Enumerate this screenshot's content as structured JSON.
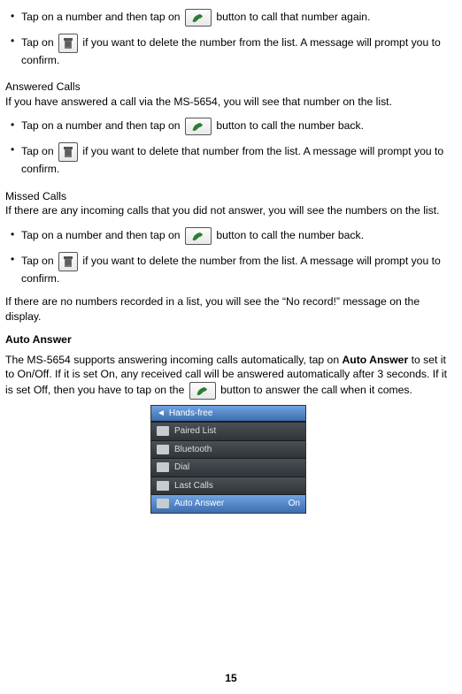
{
  "page_number": "15",
  "top_bullets": [
    {
      "pre": "Tap on a number and then tap on ",
      "icon": "phone",
      "post": " button to call that number again."
    },
    {
      "pre": "Tap on ",
      "icon": "trash",
      "post": " if you want to delete the number from the list. A message will prompt you to confirm."
    }
  ],
  "answered": {
    "title": "Answered Calls",
    "intro": "If you have answered a call via the MS-5654, you will see that number on the list.",
    "bullets": [
      {
        "pre": "Tap on a number and then tap on ",
        "icon": "phone",
        "post": " button to call the number back."
      },
      {
        "pre": "Tap on ",
        "icon": "trash",
        "post": " if you want to delete that number from the list. A message will prompt you to confirm."
      }
    ]
  },
  "missed": {
    "title": "Missed Calls",
    "intro": "If there are any incoming calls that you did not answer, you will see the numbers on the list.",
    "bullets": [
      {
        "pre": "Tap on a number and then tap on ",
        "icon": "phone",
        "post": " button to call the number back."
      },
      {
        "pre": "Tap on ",
        "icon": "trash",
        "post": " if you want to delete the number from the list. A message will prompt you to confirm."
      }
    ]
  },
  "no_record": "If there are no numbers recorded in a list, you will see the “No record!” message on the display.",
  "auto_answer": {
    "title": "Auto Answer",
    "line1_pre": "The MS-5654 supports answering incoming calls automatically, tap on ",
    "line1_bold": "Auto Answer",
    "line1_post": " to set it to On/Off. If it is set On, any received call will be answered automatically after 3 seconds. If it is set Off, then you have to tap on the ",
    "line1_tail": " button to answer the call when it comes."
  },
  "menu": {
    "header": "Hands-free",
    "rows": [
      {
        "label": "Paired List",
        "value": ""
      },
      {
        "label": "Bluetooth",
        "value": ""
      },
      {
        "label": "Dial",
        "value": ""
      },
      {
        "label": "Last Calls",
        "value": ""
      },
      {
        "label": "Auto Answer",
        "value": "On",
        "selected": true
      }
    ]
  }
}
